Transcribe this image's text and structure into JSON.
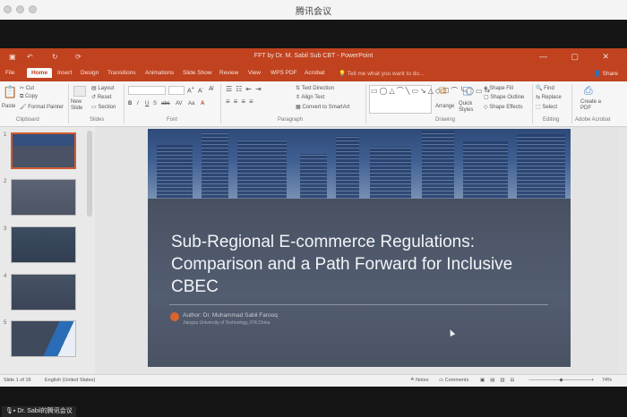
{
  "meeting": {
    "title": "腾讯会议"
  },
  "ppt": {
    "doc_title": "FFT by Dr. M. Sabil Sub CBT - PowerPoint",
    "quick_access": [
      "↶",
      "↻",
      "⟳"
    ],
    "window_controls": "— ▢ ✕",
    "tabs": [
      "File",
      "Home",
      "Insert",
      "Design",
      "Transitions",
      "Animations",
      "Slide Show",
      "Review",
      "View",
      "WPS PDF",
      "Acrobat"
    ],
    "tell_me": "Tell me what you want to do...",
    "share": "Share",
    "ribbon": {
      "clipboard": {
        "paste": "Paste",
        "cut": "Cut",
        "copy": "Copy",
        "format_painter": "Format Painter",
        "label": "Clipboard"
      },
      "slides": {
        "new_slide": "New Slide",
        "layout": "Layout",
        "reset": "Reset",
        "section": "Section",
        "label": "Slides"
      },
      "font": {
        "label": "Font",
        "buttons": [
          "B",
          "I",
          "U",
          "S",
          "abc",
          "AV",
          "Aa",
          "A"
        ]
      },
      "paragraph": {
        "label": "Paragraph",
        "text_direction": "Text Direction",
        "align_text": "Align Text",
        "convert": "Convert to SmartArt"
      },
      "drawing": {
        "label": "Drawing",
        "arrange": "Arrange",
        "quick_styles": "Quick Styles",
        "shape_fill": "Shape Fill",
        "shape_outline": "Shape Outline",
        "shape_effects": "Shape Effects"
      },
      "editing": {
        "label": "Editing",
        "find": "Find",
        "replace": "Replace",
        "select": "Select"
      },
      "acrobat": {
        "label": "Adobe Acrobat",
        "create_pdf": "Create a PDF"
      }
    },
    "slides_panel": {
      "numbers": [
        "1",
        "2",
        "3",
        "4",
        "5"
      ]
    },
    "slide": {
      "title_lines": [
        "Sub-Regional E-commerce Regulations:",
        "Comparison and a Path Forward for Inclusive",
        "CBEC"
      ],
      "author": "Author: Dr. Muhammad Sabil Farooq",
      "affiliation": "Jiangsu University of Technology, P.R.China"
    },
    "status": {
      "slide_count": "Slide 1 of 16",
      "language": "English (United States)",
      "notes": "Notes",
      "comments": "Comments",
      "zoom": "74%"
    }
  },
  "participant": {
    "name": "Dr. Sabil的腾讯会议"
  },
  "colors": {
    "accent": "#c0421f",
    "slide_bg": "#4b5566",
    "author_dot": "#d9632e"
  }
}
